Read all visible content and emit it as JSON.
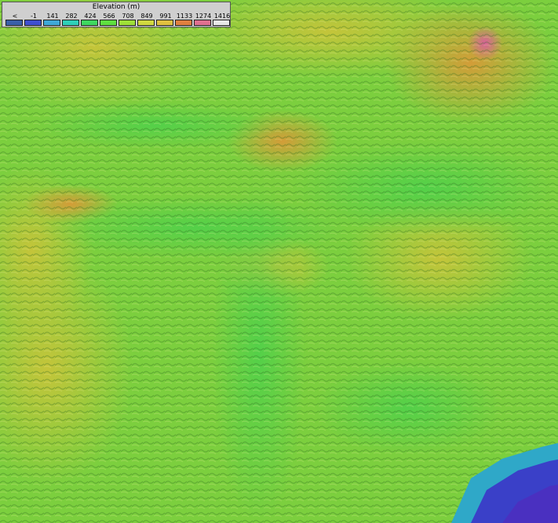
{
  "legend": {
    "title": "Elevation (m)",
    "labels": [
      "<",
      "-1",
      "141",
      "282",
      "424",
      "566",
      "708",
      "849",
      "991",
      "1133",
      "1274",
      "1416"
    ],
    "swatch_colors": [
      "#3a5fa8",
      "#3f4fd0",
      "#3fa8d8",
      "#2fd0b8",
      "#3fd860",
      "#5fe040",
      "#9fe038",
      "#d0d840",
      "#e0c040",
      "#e08040",
      "#e07090",
      "#e8e8e8"
    ]
  },
  "terrain_colors": {
    "low_water": "#3a40c8",
    "valley": "#55d048",
    "plain": "#7fd83a",
    "hills": "#c8d03a",
    "ridge": "#d8a03a",
    "peak": "#d8609a"
  }
}
